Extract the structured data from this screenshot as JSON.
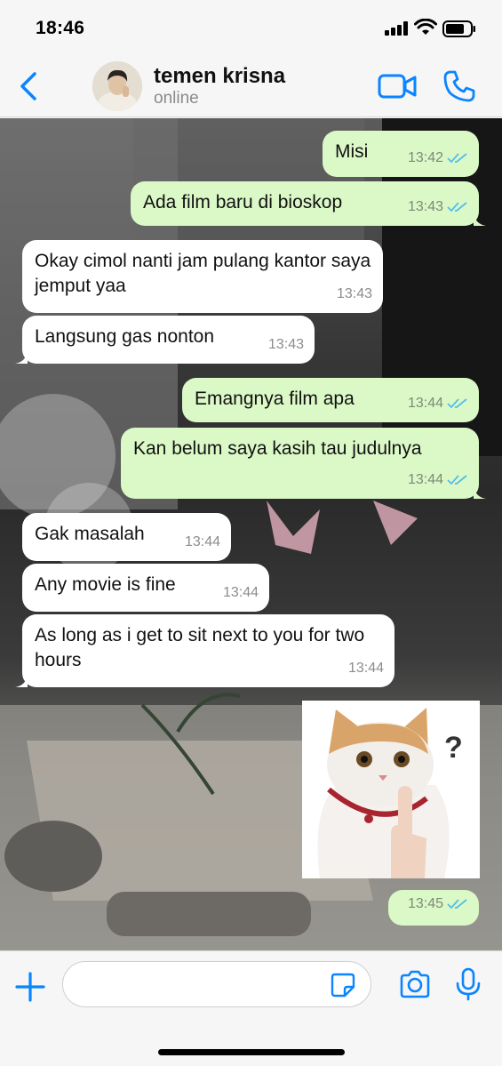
{
  "status_bar": {
    "time": "18:46"
  },
  "header": {
    "contact_name": "temen krisna",
    "presence": "online",
    "back_icon": "chevron-left-icon",
    "video_icon": "video-camera-icon",
    "call_icon": "phone-icon"
  },
  "messages": [
    {
      "direction": "outgoing",
      "text": "Misi",
      "time": "13:42",
      "read": true
    },
    {
      "direction": "outgoing",
      "text": "Ada film baru di bioskop",
      "time": "13:43",
      "read": true
    },
    {
      "direction": "incoming",
      "text": "Okay cimol nanti jam pulang kantor saya jemput yaa",
      "time": "13:43"
    },
    {
      "direction": "incoming",
      "text": "Langsung gas nonton",
      "time": "13:43"
    },
    {
      "direction": "outgoing",
      "text": "Emangnya film apa",
      "time": "13:44",
      "read": true
    },
    {
      "direction": "outgoing",
      "text": "Kan belum saya kasih tau judulnya",
      "time": "13:44",
      "read": true
    },
    {
      "direction": "incoming",
      "text": "Gak masalah",
      "time": "13:44"
    },
    {
      "direction": "incoming",
      "text": "Any movie is fine",
      "time": "13:44"
    },
    {
      "direction": "incoming",
      "text": "As long as i get to sit next to you for two hours",
      "time": "13:44"
    },
    {
      "direction": "outgoing",
      "type": "sticker",
      "sticker_icon": "confused-cat-sticker",
      "sticker_text": "?",
      "time": "13:45",
      "read": true
    }
  ],
  "input_bar": {
    "plus_icon": "plus-icon",
    "sticker_icon": "sticker-icon",
    "camera_icon": "camera-icon",
    "mic_icon": "microphone-icon",
    "placeholder": ""
  },
  "colors": {
    "accent": "#0a84ff",
    "outgoing_bubble": "#dbf8c7",
    "incoming_bubble": "#ffffff",
    "read_ticks": "#53bdeb"
  }
}
